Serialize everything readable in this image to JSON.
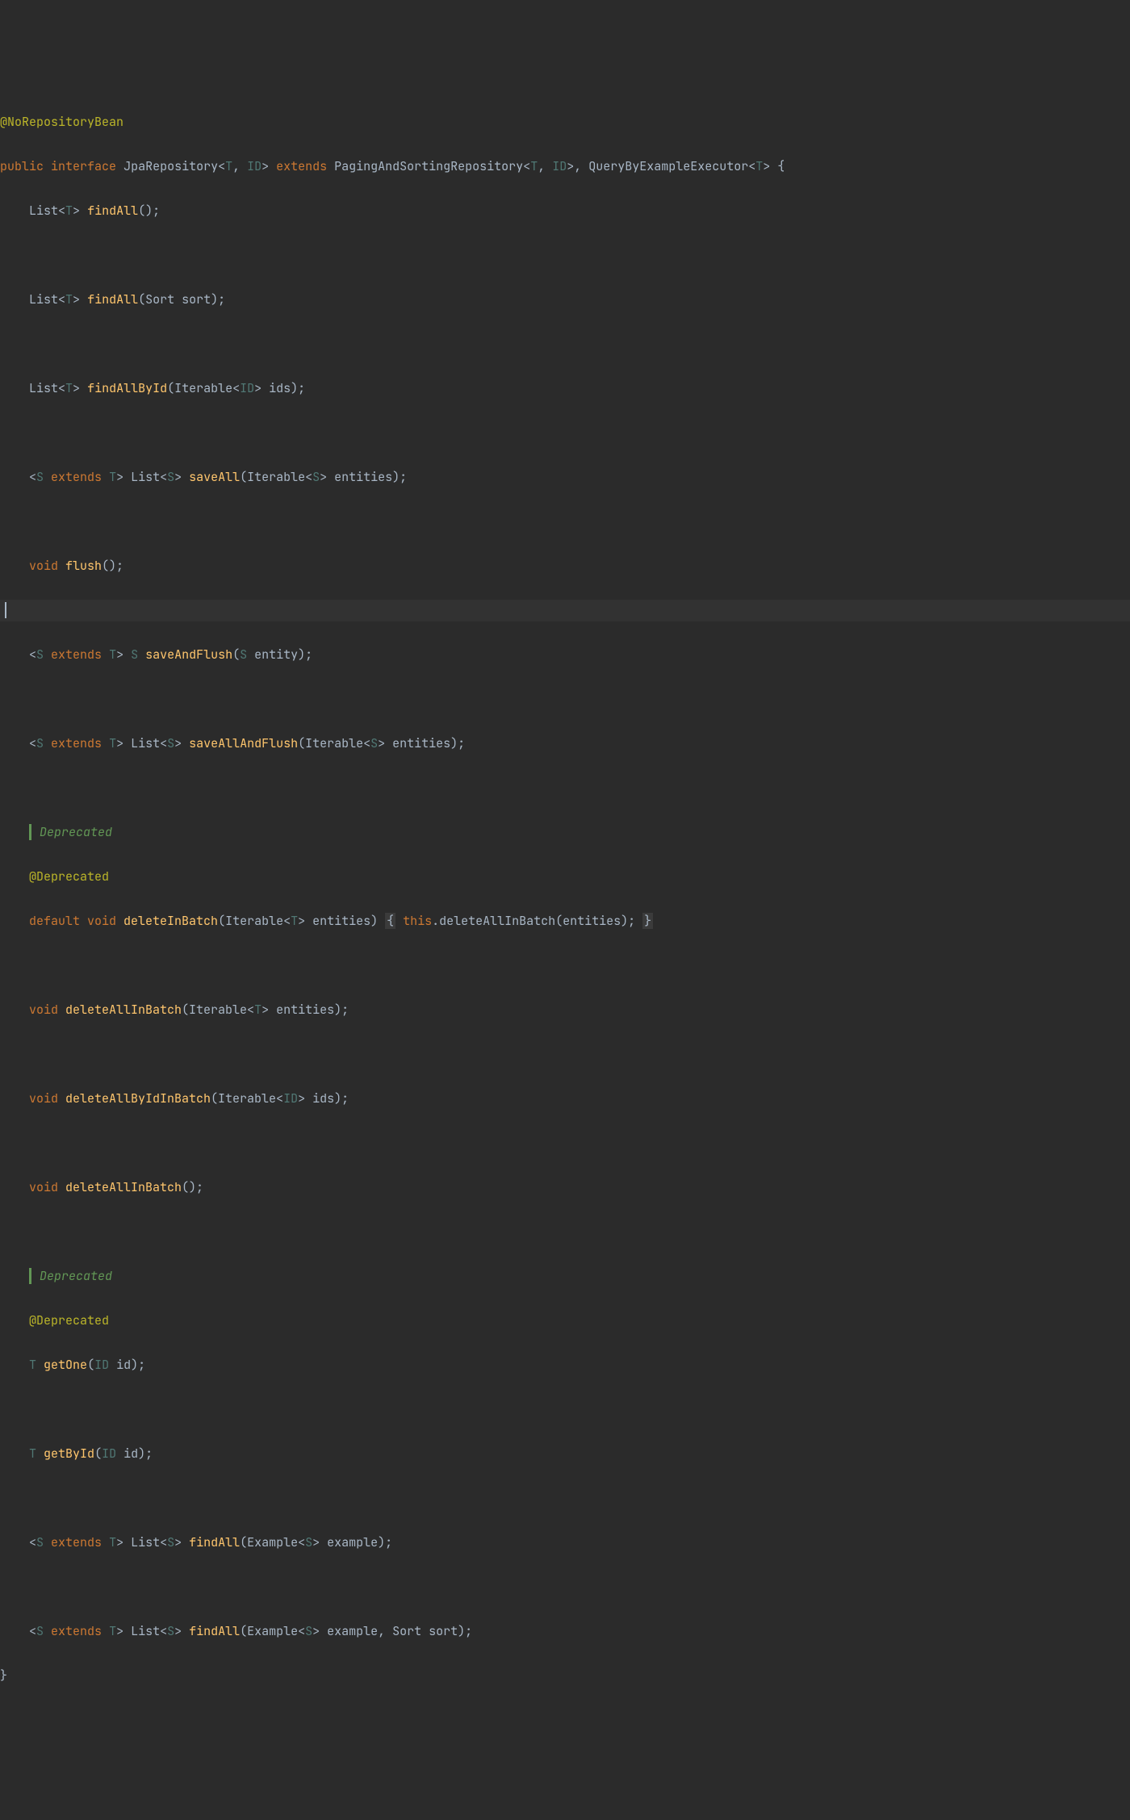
{
  "indent1": "    ",
  "colors": {
    "background": "#2b2b2b",
    "keyword": "#cc7832",
    "annotation": "#bbb529",
    "method": "#ffc66d",
    "generic": "#507874",
    "doc": "#629755",
    "default": "#a9b7c6"
  },
  "code": {
    "annotation_top": "@NoRepositoryBean",
    "decl": {
      "public": "public",
      "interface": "interface",
      "name": "JpaRepository",
      "generics_open": "<",
      "T": "T",
      "comma1": ", ",
      "ID": "ID",
      "generics_close": "> ",
      "extends": "extends",
      "parent1": " PagingAndSortingRepository<",
      "p1_T": "T",
      "p1_comma": ", ",
      "p1_ID": "ID",
      "p1_close": ">, QueryByExampleExecutor<",
      "p2_T": "T",
      "p2_close": "> {"
    },
    "m1": {
      "ret": "List<",
      "g": "T",
      "ret2": "> ",
      "name": "findAll",
      "rest": "();"
    },
    "m2": {
      "ret": "List<",
      "g": "T",
      "ret2": "> ",
      "name": "findAll",
      "rest": "(Sort sort);"
    },
    "m3": {
      "ret": "List<",
      "g": "T",
      "ret2": "> ",
      "name": "findAllById",
      "rest": "(Iterable<",
      "g2": "ID",
      "rest2": "> ids);"
    },
    "m4": {
      "pre": "<",
      "S": "S",
      "ext": " extends ",
      "T": "T",
      "pre2": "> List<",
      "S2": "S",
      "pre3": "> ",
      "name": "saveAll",
      "rest": "(Iterable<",
      "S3": "S",
      "rest2": "> entities);"
    },
    "m5": {
      "void": "void",
      "name": " flush",
      "rest": "();"
    },
    "m6": {
      "pre": "<",
      "S": "S",
      "ext": " extends ",
      "T": "T",
      "pre2": "> ",
      "S2": "S",
      "sp": " ",
      "name": "saveAndFlush",
      "rest": "(",
      "S3": "S",
      "rest2": " entity);"
    },
    "m7": {
      "pre": "<",
      "S": "S",
      "ext": " extends ",
      "T": "T",
      "pre2": "> List<",
      "S2": "S",
      "pre3": "> ",
      "name": "saveAllAndFlush",
      "rest": "(Iterable<",
      "S3": "S",
      "rest2": "> entities);"
    },
    "doc1": "Deprecated",
    "dep_ann": "@Deprecated",
    "m8": {
      "default": "default",
      "void": " void ",
      "name": "deleteInBatch",
      "rest": "(Iterable<",
      "T": "T",
      "rest2": "> entities) ",
      "brace1": "{",
      "this": " this",
      "call": ".deleteAllInBatch(entities); ",
      "brace2": "}"
    },
    "m9": {
      "void": "void ",
      "name": "deleteAllInBatch",
      "rest": "(Iterable<",
      "T": "T",
      "rest2": "> entities);"
    },
    "m10": {
      "void": "void ",
      "name": "deleteAllByIdInBatch",
      "rest": "(Iterable<",
      "ID": "ID",
      "rest2": "> ids);"
    },
    "m11": {
      "void": "void ",
      "name": "deleteAllInBatch",
      "rest": "();"
    },
    "doc2": "Deprecated",
    "dep_ann2": "@Deprecated",
    "m12": {
      "T": "T",
      "sp": " ",
      "name": "getOne",
      "rest": "(",
      "ID": "ID",
      "rest2": " id);"
    },
    "m13": {
      "T": "T",
      "sp": " ",
      "name": "getById",
      "rest": "(",
      "ID": "ID",
      "rest2": " id);"
    },
    "m14": {
      "pre": "<",
      "S": "S",
      "ext": " extends ",
      "T": "T",
      "pre2": "> List<",
      "S2": "S",
      "pre3": "> ",
      "name": "findAll",
      "rest": "(Example<",
      "S3": "S",
      "rest2": "> example);"
    },
    "m15": {
      "pre": "<",
      "S": "S",
      "ext": " extends ",
      "T": "T",
      "pre2": "> List<",
      "S2": "S",
      "pre3": "> ",
      "name": "findAll",
      "rest": "(Example<",
      "S3": "S",
      "rest2": "> example, Sort sort);"
    },
    "close": "}"
  }
}
